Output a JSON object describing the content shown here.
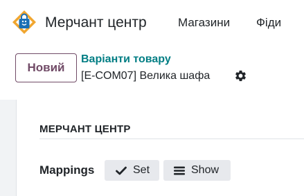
{
  "navbar": {
    "app_title": "Мерчант центр",
    "menu": [
      {
        "label": "Магазини"
      },
      {
        "label": "Фіди"
      }
    ]
  },
  "control_panel": {
    "new_button_label": "Новий",
    "breadcrumb_parent": "Варіанти товару",
    "breadcrumb_current": "[E-COM07] Велика шафа"
  },
  "form": {
    "section_title": "МЕРЧАНТ ЦЕНТР",
    "field_label": "Mappings",
    "buttons": [
      {
        "label": "Set",
        "icon": "check-icon"
      },
      {
        "label": "Show",
        "icon": "bars-icon"
      }
    ]
  },
  "colors": {
    "brand_primary": "#714b67",
    "link_teal": "#017e84",
    "logo_orange": "#f0a630",
    "logo_blue": "#1a6fb5"
  }
}
